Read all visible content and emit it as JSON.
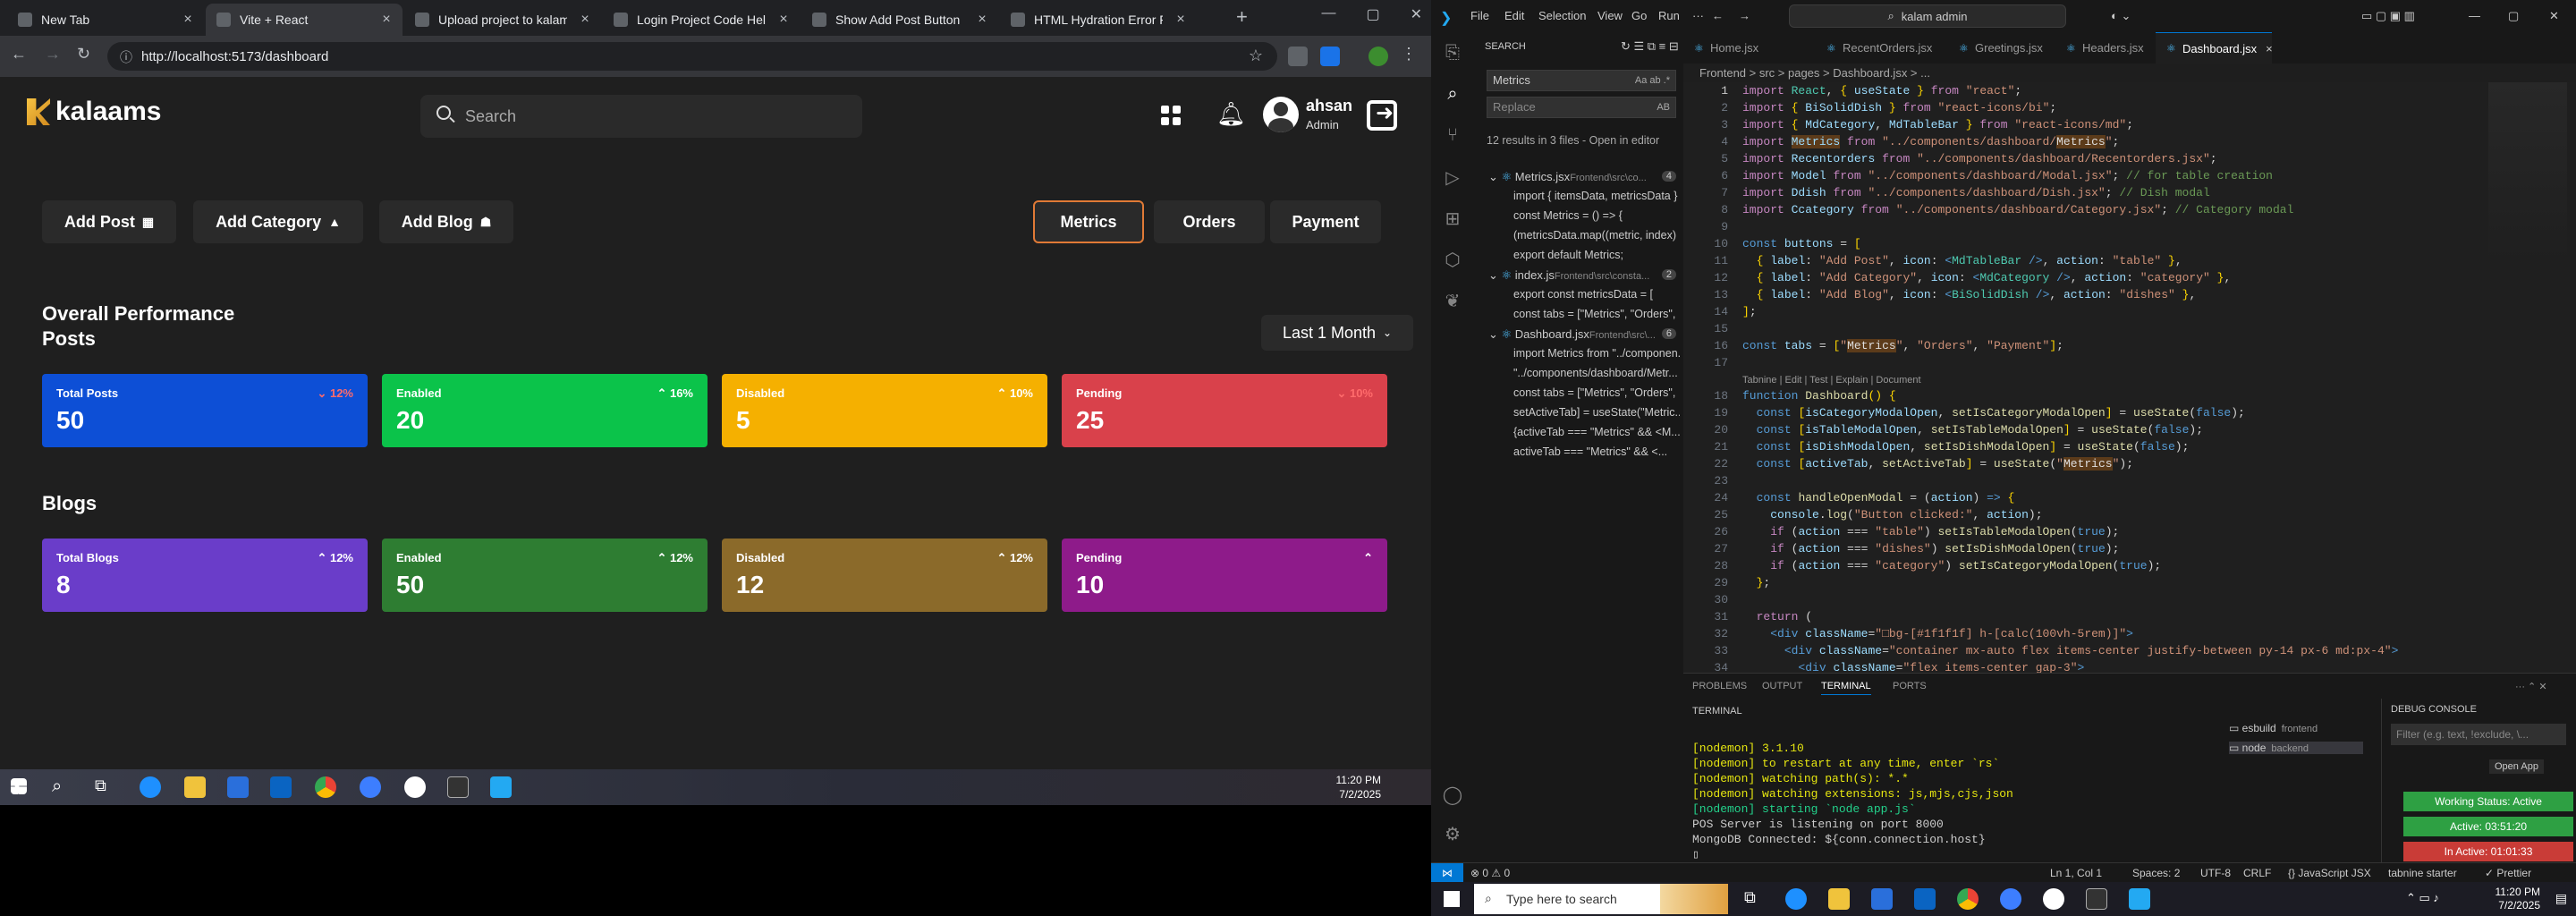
{
  "browser": {
    "tabs": [
      {
        "title": "New Tab",
        "active": false
      },
      {
        "title": "Vite + React",
        "active": true
      },
      {
        "title": "Upload project to kalams.org",
        "active": false
      },
      {
        "title": "Login Project Code Help",
        "active": false
      },
      {
        "title": "Show Add Post Button",
        "active": false
      },
      {
        "title": "HTML Hydration Error Fix",
        "active": false
      }
    ],
    "url": "http://localhost:5173/dashboard"
  },
  "app": {
    "logo_text": "kalaams",
    "search_placeholder": "Search",
    "user": {
      "name": "ahsan",
      "role": "Admin"
    },
    "actions": [
      {
        "label": "Add Post",
        "icon": "table-icon"
      },
      {
        "label": "Add Category",
        "icon": "category-icon"
      },
      {
        "label": "Add Blog",
        "icon": "dish-icon"
      }
    ],
    "tabs": [
      {
        "label": "Metrics",
        "active": true
      },
      {
        "label": "Orders",
        "active": false
      },
      {
        "label": "Payment",
        "active": false
      }
    ],
    "overall_title": "Overall Performance",
    "posts_title": "Posts",
    "range_label": "Last 1 Month",
    "posts_cards": [
      {
        "label": "Total Posts",
        "value": "50",
        "trend": "12%",
        "up": false,
        "color": "#0d4fd6"
      },
      {
        "label": "Enabled",
        "value": "20",
        "trend": "16%",
        "up": true,
        "color": "#0bc34a"
      },
      {
        "label": "Disabled",
        "value": "5",
        "trend": "10%",
        "up": true,
        "color": "#f5b000"
      },
      {
        "label": "Pending",
        "value": "25",
        "trend": "10%",
        "up": false,
        "color": "#d9414b"
      }
    ],
    "blogs_title": "Blogs",
    "blogs_cards": [
      {
        "label": "Total Blogs",
        "value": "8",
        "trend": "12%",
        "up": true,
        "color": "#6a3dc9"
      },
      {
        "label": "Enabled",
        "value": "50",
        "trend": "12%",
        "up": true,
        "color": "#2e7d32"
      },
      {
        "label": "Disabled",
        "value": "12",
        "trend": "12%",
        "up": true,
        "color": "#8b6a2a"
      },
      {
        "label": "Pending",
        "value": "10",
        "trend": "",
        "up": true,
        "color": "#8e1b8a"
      }
    ]
  },
  "taskbar_left": {
    "time": "11:20 PM",
    "date": "7/2/2025"
  },
  "vscode": {
    "menu": [
      "File",
      "Edit",
      "Selection",
      "View",
      "Go",
      "Run",
      "···"
    ],
    "command_center": "kalam admin",
    "search": {
      "header": "SEARCH",
      "query": "Metrics",
      "replace_placeholder": "Replace",
      "summary": "12 results in 3 files - Open in editor",
      "files": [
        {
          "name": "Metrics.jsx",
          "path": "Frontend\\src\\co...",
          "count": "4",
          "results": [
            "import { itemsData, metricsData } ...",
            "const Metrics = () => {",
            "(metricsData.map((metric, index) =>",
            "export default Metrics;"
          ]
        },
        {
          "name": "index.js",
          "path": "Frontend\\src\\consta...",
          "count": "2",
          "results": [
            "export const metricsData = [",
            "const tabs = [\"Metrics\", \"Orders\", ..."
          ]
        },
        {
          "name": "Dashboard.jsx",
          "path": "Frontend\\src\\...",
          "count": "6",
          "results": [
            "import Metrics from \"../componen...",
            "\"../components/dashboard/Metr...",
            "const tabs = [\"Metrics\", \"Orders\",",
            "setActiveTab] = useState(\"Metric...",
            "{activeTab === \"Metrics\" && <M...",
            "activeTab === \"Metrics\" && <..."
          ]
        }
      ]
    },
    "editor_tabs": [
      "Home.jsx",
      "RecentOrders.jsx",
      "Greetings.jsx",
      "Headers.jsx",
      "Dashboard.jsx"
    ],
    "active_editor_tab": "Dashboard.jsx",
    "breadcrumb": "Frontend > src > pages > Dashboard.jsx > ...",
    "codelens": "Tabnine | Edit | Test | Explain | Document",
    "panel_tabs": [
      "PROBLEMS",
      "OUTPUT",
      "TERMINAL",
      "PORTS"
    ],
    "terminal_header": "TERMINAL",
    "terminal_lines": [
      "[nodemon] 3.1.10",
      "[nodemon] to restart at any time, enter `rs`",
      "[nodemon] watching path(s): *.*",
      "[nodemon] watching extensions: js,mjs,cjs,json",
      "[nodemon] starting `node app.js`",
      "POS Server is listening on port 8000",
      "MongoDB Connected: ${conn.connection.host}"
    ],
    "processes": [
      {
        "name": "esbuild",
        "label": "frontend"
      },
      {
        "name": "node",
        "label": "backend"
      }
    ],
    "debug_header": "DEBUG CONSOLE",
    "debug_filter": "Filter (e.g. text, !exclude, \\...",
    "open_app": "Open App",
    "status_pills": [
      {
        "text": "Working Status: Active",
        "color": "#2ea043"
      },
      {
        "text": "Active: 03:51:20",
        "color": "#2ea043"
      },
      {
        "text": "In Active: 01:01:33",
        "color": "#c93c37"
      }
    ],
    "statusbar": {
      "left": "⊗ 0 ⚠ 0",
      "position": "Ln 1, Col 1",
      "spaces": "Spaces: 2",
      "encoding": "UTF-8",
      "eol": "CRLF",
      "language": "{} JavaScript JSX",
      "tabnine": "tabnine starter",
      "prettier": "✓ Prettier"
    }
  },
  "taskbar_right": {
    "search_placeholder": "Type here to search",
    "time": "11:20 PM",
    "date": "7/2/2025"
  }
}
